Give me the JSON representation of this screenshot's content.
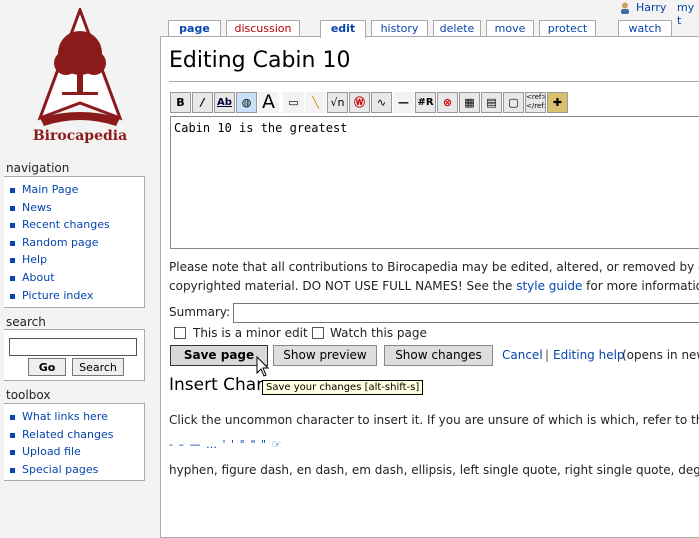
{
  "site": {
    "name": "Birocapedia"
  },
  "user_links": [
    "Harry",
    "my t"
  ],
  "tabs": [
    {
      "label": "page",
      "selected": true,
      "red": false
    },
    {
      "label": "discussion",
      "selected": false,
      "red": true
    },
    {
      "label": "edit",
      "selected": true,
      "red": false
    },
    {
      "label": "history",
      "selected": false,
      "red": false
    },
    {
      "label": "delete",
      "selected": false,
      "red": false
    },
    {
      "label": "move",
      "selected": false,
      "red": false
    },
    {
      "label": "protect",
      "selected": false,
      "red": false
    },
    {
      "label": "watch",
      "selected": false,
      "red": false
    }
  ],
  "navigation": {
    "title": "navigation",
    "items": [
      "Main Page",
      "News",
      "Recent changes",
      "Random page",
      "Help",
      "About",
      "Picture index"
    ]
  },
  "search": {
    "title": "search",
    "go_label": "Go",
    "search_label": "Search",
    "value": ""
  },
  "toolbox": {
    "title": "toolbox",
    "items": [
      "What links here",
      "Related changes",
      "Upload file",
      "Special pages"
    ]
  },
  "page": {
    "title": "Editing Cabin 10",
    "edit_text": "Cabin 10 is the greatest",
    "note_line1": "Please note that all contributions to Birocapedia may be edited, altered, or removed by othe",
    "note_line2_prefix": "copyrighted material. DO NOT USE FULL NAMES! See the ",
    "note_line2_link": "style guide",
    "note_line2_suffix": " for more information.",
    "summary_label": "Summary:",
    "summary_value": "",
    "minor_edit_label": "This is a minor edit",
    "watch_label": "Watch this page",
    "save_label": "Save page",
    "preview_label": "Show preview",
    "changes_label": "Show changes",
    "cancel_label": "Cancel",
    "separator": "|",
    "editing_help_label": "Editing help",
    "editing_help_suffix": " (opens in new",
    "tooltip": "Save your changes [alt-shift-s]",
    "insert_title": "Insert Char",
    "insert_text": "Click the uncommon character to insert it. If you are unsure of which is which, refer to the ke",
    "special_chars": "- – — … ' ' ° \" \" ☞",
    "char_names": "hyphen, figure dash, en dash, em dash, ellipsis, left single quote, right single quote, degree, l"
  },
  "toolbar_icons": [
    "bold-icon",
    "italic-icon",
    "link-icon",
    "external-link-icon",
    "heading-icon",
    "image-icon",
    "media-icon",
    "math-icon",
    "nowiki-icon",
    "signature-icon",
    "hr-icon",
    "redirect-icon",
    "strike-icon",
    "gallery-icon",
    "quote-icon",
    "table-icon",
    "ref-icon",
    "insert-icon"
  ]
}
